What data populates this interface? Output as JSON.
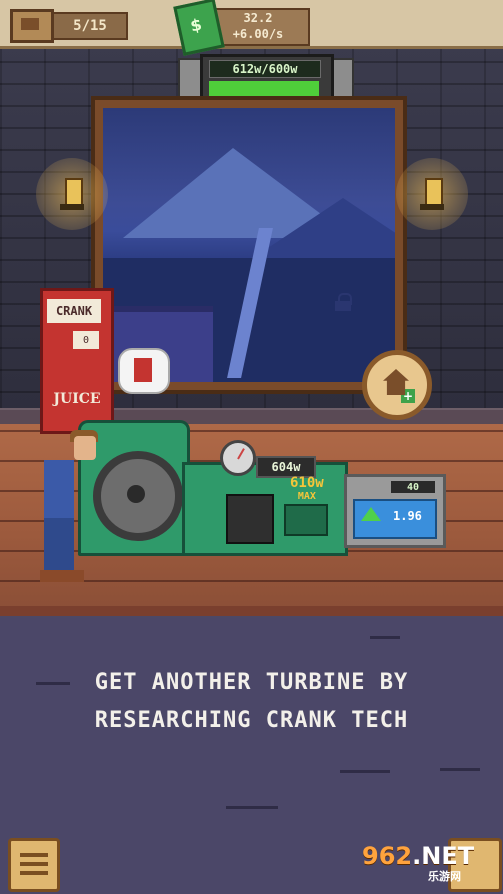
{
  "topbar": {
    "level_counter": "5/15",
    "money": "32.2",
    "income_rate": "+6.00/s"
  },
  "power_meter": {
    "label": "612w/600w",
    "fill_fraction": 1.0
  },
  "juice_machine": {
    "header": "CRANK",
    "slot_count": "0",
    "logo": "JUICE"
  },
  "generator": {
    "output": "604w",
    "max_output": "610w",
    "max_label": "MAX"
  },
  "upgrade_panel": {
    "level": "40",
    "cost": "1.96"
  },
  "tutorial": {
    "line1": "GET ANOTHER TURBINE BY",
    "line2": "RESEARCHING CRANK TECH"
  },
  "watermark": {
    "brand_number": "962",
    "brand_suffix": ".NET",
    "site": "乐游网"
  },
  "colors": {
    "power_fill": "#4fce3a",
    "wall": "#3b3b4d",
    "floor": "#b06a48",
    "tutorial_bg": "#4b4768",
    "machine_green": "#2f9a6a"
  },
  "icons": [
    "house-icon",
    "cash-icon",
    "lock-icon",
    "lamp-icon",
    "home-plus-icon",
    "juice-icon",
    "upgrade-arrow-icon",
    "menu-icon"
  ]
}
